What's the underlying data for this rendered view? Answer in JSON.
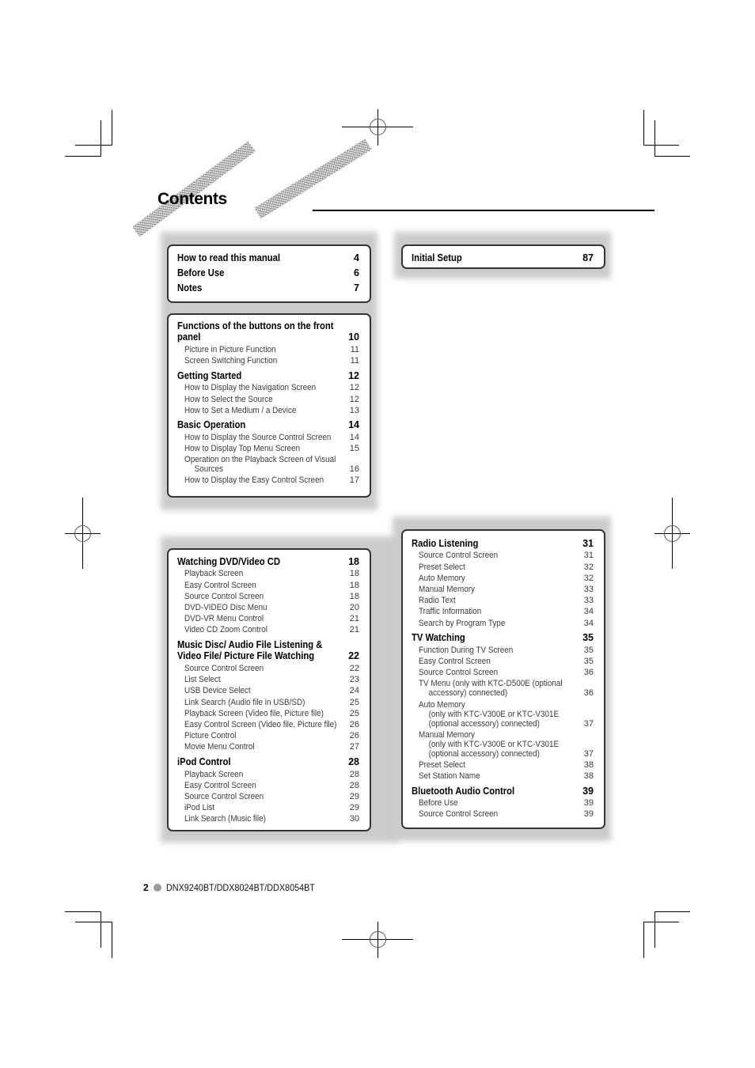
{
  "document": {
    "heading": "Contents"
  },
  "toc": {
    "intro_box": [
      {
        "level": "section",
        "lines": [
          "How to read this manual"
        ],
        "page": "4"
      },
      {
        "level": "section",
        "lines": [
          "Before Use"
        ],
        "page": "6"
      },
      {
        "level": "section",
        "lines": [
          "Notes"
        ],
        "page": "7"
      }
    ],
    "functions_box": [
      {
        "level": "section",
        "lines": [
          "Functions of the buttons on the front",
          "panel"
        ],
        "page": "10"
      },
      {
        "level": "sub",
        "lines": [
          "Picture in Picture Function"
        ],
        "page": "11"
      },
      {
        "level": "sub",
        "lines": [
          "Screen Switching Function"
        ],
        "page": "11"
      },
      {
        "level": "section",
        "lines": [
          "Getting Started"
        ],
        "page": "12"
      },
      {
        "level": "sub",
        "lines": [
          "How to Display the Navigation Screen"
        ],
        "page": "12"
      },
      {
        "level": "sub",
        "lines": [
          "How to Select the Source"
        ],
        "page": "12"
      },
      {
        "level": "sub",
        "lines": [
          "How to Set a Medium / a Device"
        ],
        "page": "13"
      },
      {
        "level": "section",
        "lines": [
          "Basic Operation"
        ],
        "page": "14"
      },
      {
        "level": "sub",
        "lines": [
          "How to Display the Source Control Screen"
        ],
        "page": "14"
      },
      {
        "level": "sub",
        "lines": [
          "How to Display Top Menu Screen"
        ],
        "page": "15"
      },
      {
        "level": "sub",
        "lines": [
          "Operation on the Playback Screen of Visual",
          "Sources"
        ],
        "page": "16"
      },
      {
        "level": "sub",
        "lines": [
          "How to Display the Easy Control Screen"
        ],
        "page": "17"
      }
    ],
    "setup_box": [
      {
        "level": "section",
        "lines": [
          "Initial Setup"
        ],
        "page": "87"
      }
    ],
    "av_box": [
      {
        "level": "section",
        "lines": [
          "Watching DVD/Video CD"
        ],
        "page": "18"
      },
      {
        "level": "sub",
        "lines": [
          "Playback Screen"
        ],
        "page": "18"
      },
      {
        "level": "sub",
        "lines": [
          "Easy Control Screen"
        ],
        "page": "18"
      },
      {
        "level": "sub",
        "lines": [
          "Source Control Screen"
        ],
        "page": "18"
      },
      {
        "level": "sub",
        "lines": [
          "DVD-VIDEO Disc Menu"
        ],
        "page": "20"
      },
      {
        "level": "sub",
        "lines": [
          "DVD-VR Menu Control"
        ],
        "page": "21"
      },
      {
        "level": "sub",
        "lines": [
          "Video CD Zoom Control"
        ],
        "page": "21"
      },
      {
        "level": "section",
        "lines": [
          "Music Disc/ Audio File Listening &",
          "Video File/ Picture File Watching"
        ],
        "page": "22"
      },
      {
        "level": "sub",
        "lines": [
          "Source Control Screen"
        ],
        "page": "22"
      },
      {
        "level": "sub",
        "lines": [
          "List Select"
        ],
        "page": "23"
      },
      {
        "level": "sub",
        "lines": [
          "USB Device Select"
        ],
        "page": "24"
      },
      {
        "level": "sub",
        "lines": [
          "Link Search (Audio file in USB/SD)"
        ],
        "page": "25"
      },
      {
        "level": "sub",
        "lines": [
          "Playback Screen (Video file, Picture file)"
        ],
        "page": "25"
      },
      {
        "level": "sub",
        "lines": [
          "Easy Control Screen (Video file, Picture file)"
        ],
        "page": "26"
      },
      {
        "level": "sub",
        "lines": [
          "Picture Control"
        ],
        "page": "26"
      },
      {
        "level": "sub",
        "lines": [
          "Movie Menu Control"
        ],
        "page": "27"
      },
      {
        "level": "section",
        "lines": [
          "iPod Control"
        ],
        "page": "28"
      },
      {
        "level": "sub",
        "lines": [
          "Playback Screen"
        ],
        "page": "28"
      },
      {
        "level": "sub",
        "lines": [
          "Easy Control Screen"
        ],
        "page": "28"
      },
      {
        "level": "sub",
        "lines": [
          "Source Control Screen"
        ],
        "page": "29"
      },
      {
        "level": "sub",
        "lines": [
          "iPod List"
        ],
        "page": "29"
      },
      {
        "level": "sub",
        "lines": [
          "Link Search (Music file)"
        ],
        "page": "30"
      }
    ],
    "radio_box": [
      {
        "level": "section",
        "lines": [
          "Radio Listening"
        ],
        "page": "31"
      },
      {
        "level": "sub",
        "lines": [
          "Source Control Screen"
        ],
        "page": "31"
      },
      {
        "level": "sub",
        "lines": [
          "Preset Select"
        ],
        "page": "32"
      },
      {
        "level": "sub",
        "lines": [
          "Auto Memory"
        ],
        "page": "32"
      },
      {
        "level": "sub",
        "lines": [
          "Manual Memory"
        ],
        "page": "33"
      },
      {
        "level": "sub",
        "lines": [
          "Radio Text"
        ],
        "page": "33"
      },
      {
        "level": "sub",
        "lines": [
          "Traffic Information"
        ],
        "page": "34"
      },
      {
        "level": "sub",
        "lines": [
          "Search by Program Type"
        ],
        "page": "34"
      },
      {
        "level": "section",
        "lines": [
          "TV Watching"
        ],
        "page": "35"
      },
      {
        "level": "sub",
        "lines": [
          "Function During TV Screen"
        ],
        "page": "35"
      },
      {
        "level": "sub",
        "lines": [
          "Easy Control Screen"
        ],
        "page": "35"
      },
      {
        "level": "sub",
        "lines": [
          "Source Control Screen"
        ],
        "page": "36"
      },
      {
        "level": "sub",
        "lines": [
          "TV Menu (only with KTC-D500E (optional",
          "accessory) connected)"
        ],
        "page": "36"
      },
      {
        "level": "sub",
        "lines": [
          "Auto Memory",
          "(only with KTC-V300E or KTC-V301E",
          "(optional accessory) connected)"
        ],
        "page": "37"
      },
      {
        "level": "sub",
        "lines": [
          "Manual Memory",
          "(only with KTC-V300E or KTC-V301E",
          "(optional accessory) connected)"
        ],
        "page": "37"
      },
      {
        "level": "sub",
        "lines": [
          "Preset Select"
        ],
        "page": "38"
      },
      {
        "level": "sub",
        "lines": [
          "Set Station Name"
        ],
        "page": "38"
      },
      {
        "level": "section",
        "lines": [
          "Bluetooth Audio Control"
        ],
        "page": "39"
      },
      {
        "level": "sub",
        "lines": [
          "Before Use"
        ],
        "page": "39"
      },
      {
        "level": "sub",
        "lines": [
          "Source Control Screen"
        ],
        "page": "39"
      }
    ]
  },
  "footer": {
    "page_number": "2",
    "models": "DNX9240BT/DDX8024BT/DDX8054BT"
  }
}
